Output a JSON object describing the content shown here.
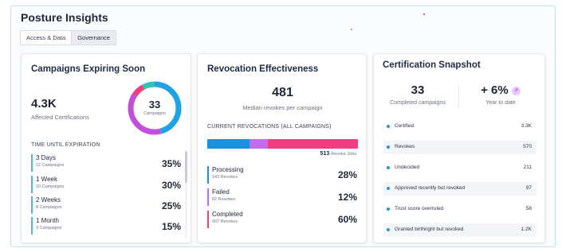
{
  "section": {
    "title": "Posture Insights",
    "tabs": [
      {
        "label": "Access & Data",
        "active": false
      },
      {
        "label": "Governance",
        "active": true
      }
    ]
  },
  "campaigns": {
    "title": "Campaigns Expiring Soon",
    "affected_value": "4.3K",
    "affected_label": "Affected Certifications",
    "donut_value": "33",
    "donut_label": "Campaigns",
    "time_heading": "TIME UNTIL EXPIRATION",
    "rows": [
      {
        "name": "3 Days",
        "sub": "12 Campaigns",
        "pct": "35%"
      },
      {
        "name": "1 Week",
        "sub": "10 Campaigns",
        "pct": "30%"
      },
      {
        "name": "2 Weeks",
        "sub": "8 Campaigns",
        "pct": "25%"
      },
      {
        "name": "1 Month",
        "sub": "3 Campaigns",
        "pct": "15%"
      }
    ]
  },
  "revocation": {
    "title": "Revocation Effectiveness",
    "median_value": "481",
    "median_label": "Median revokes per campaign",
    "current_heading": "CURRENT REVOCATIONS (ALL CAMPAIGNS)",
    "total_value": "513",
    "total_label": "Revoke Jobs",
    "rows": [
      {
        "name": "Processing",
        "sub": "143 Revokes",
        "pct": "28%",
        "share": 28,
        "color": "#1b8fe0"
      },
      {
        "name": "Failed",
        "sub": "62 Revokes",
        "pct": "12%",
        "share": 12,
        "color": "#c26bf0"
      },
      {
        "name": "Completed",
        "sub": "307 Revokes",
        "pct": "60%",
        "share": 60,
        "color": "#ef3f80"
      }
    ]
  },
  "snapshot": {
    "title": "Certification Snapshot",
    "completed_value": "33",
    "completed_label": "Completed campaigns",
    "ytd_value": "+ 6%",
    "ytd_label": "Year to date",
    "ytd_icon": "trend-arrow-icon",
    "rows": [
      {
        "label": "Certified",
        "value": "3.3K"
      },
      {
        "label": "Revokes",
        "value": "570"
      },
      {
        "label": "Undecided",
        "value": "211"
      },
      {
        "label": "Approved recently but revoked",
        "value": "97"
      },
      {
        "label": "Trust score overruled",
        "value": "58"
      },
      {
        "label": "Granted birthright but revoked",
        "value": "1.2K"
      }
    ]
  },
  "colors": {
    "donut_segments": [
      "#1fa2e6",
      "#c14fd9",
      "#ef3f80",
      "#2ec4b6"
    ],
    "row_accent": "#5fb6c9",
    "bullet": "#2f8fd6"
  }
}
